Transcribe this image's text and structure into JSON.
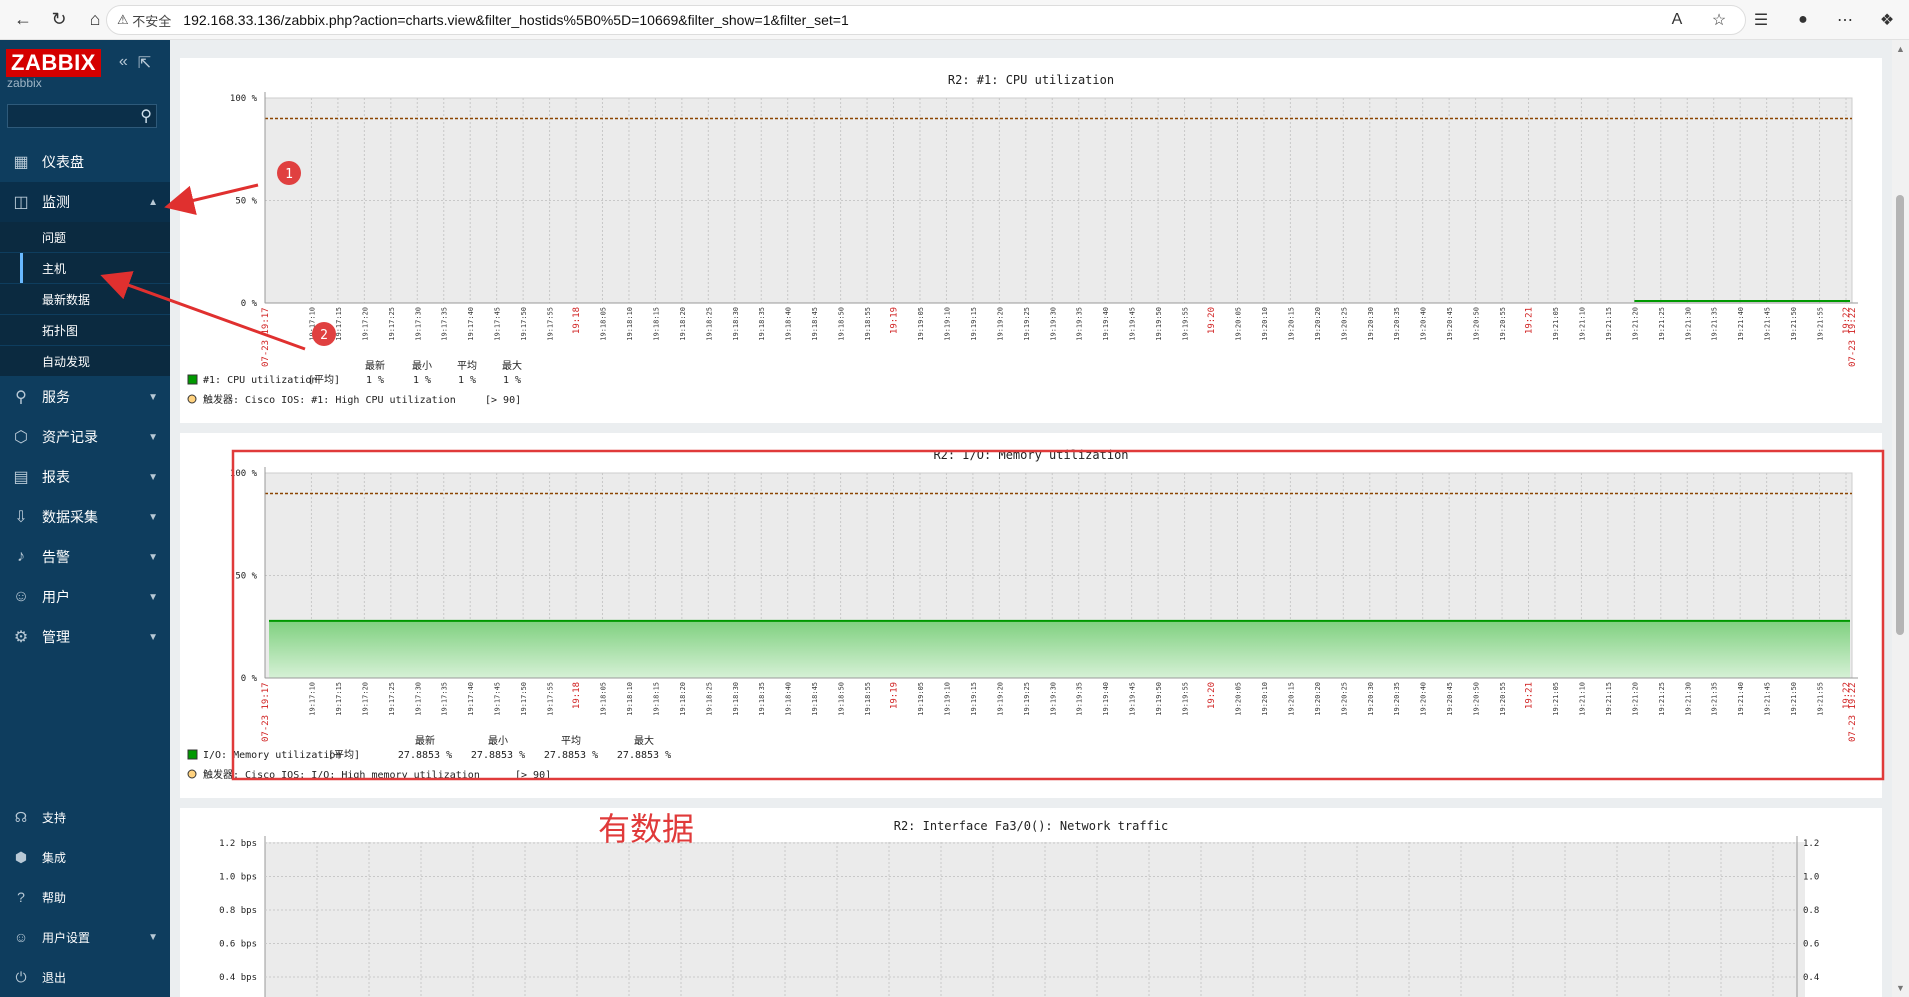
{
  "browser": {
    "security_label": "不安全",
    "url": "192.168.33.136/zabbix.php?action=charts.view&filter_hostids%5B0%5D=10669&filter_show=1&filter_set=1"
  },
  "sidebar": {
    "logo": "ZABBIX",
    "username": "zabbix",
    "search_placeholder": "",
    "items": [
      {
        "label": "仪表盘",
        "icon": "dashboard-icon"
      },
      {
        "label": "监测",
        "icon": "monitoring-icon"
      },
      {
        "label": "服务",
        "icon": "services-icon"
      },
      {
        "label": "资产记录",
        "icon": "inventory-icon"
      },
      {
        "label": "报表",
        "icon": "reports-icon"
      },
      {
        "label": "数据采集",
        "icon": "data-collection-icon"
      },
      {
        "label": "告警",
        "icon": "alerts-icon"
      },
      {
        "label": "用户",
        "icon": "users-icon"
      },
      {
        "label": "管理",
        "icon": "admin-icon"
      }
    ],
    "submenu": [
      "问题",
      "主机",
      "最新数据",
      "拓扑图",
      "自动发现"
    ],
    "bottom": [
      {
        "label": "支持",
        "icon": "support-icon"
      },
      {
        "label": "集成",
        "icon": "integrations-icon"
      },
      {
        "label": "帮助",
        "icon": "help-icon"
      },
      {
        "label": "用户设置",
        "icon": "user-settings-icon"
      },
      {
        "label": "退出",
        "icon": "logout-icon"
      }
    ]
  },
  "annotations": {
    "marker1": "1",
    "marker2": "2",
    "note": "有数据"
  },
  "legend_headers": {
    "last": "最新",
    "min": "最小",
    "avg": "平均",
    "max": "最大"
  },
  "chart_data": [
    {
      "type": "line",
      "title": "R2: #1: CPU utilization",
      "y_ticks": [
        "100 %",
        "50 %",
        "0 %"
      ],
      "ylim": [
        0,
        100
      ],
      "threshold": 90,
      "series": [
        {
          "name": "#1: CPU utilization",
          "func": "[平均]",
          "last": "1 %",
          "min": "1 %",
          "avg": "1 %",
          "max": "1 %",
          "color": "#009900",
          "x": [
            "19:21:20",
            "19:22:10"
          ],
          "values": [
            1,
            1
          ]
        }
      ],
      "trigger": {
        "label": "触发器: Cisco IOS: #1: High CPU utilization",
        "cond": "[> 90]"
      }
    },
    {
      "type": "area",
      "title": "R2: I/O: Memory utilization",
      "y_ticks": [
        "100 %",
        "50 %",
        "0 %"
      ],
      "ylim": [
        0,
        100
      ],
      "threshold": 90,
      "series": [
        {
          "name": "I/O: Memory utilization",
          "func": "[平均]",
          "last": "27.8853 %",
          "min": "27.8853 %",
          "avg": "27.8853 %",
          "max": "27.8853 %",
          "color": "#009900",
          "x": [
            "19:17:05",
            "19:22:10"
          ],
          "values": [
            27.8853,
            27.8853
          ]
        }
      ],
      "trigger": {
        "label": "触发器: Cisco IOS: I/O: High memory utilization",
        "cond": "[> 90]"
      }
    },
    {
      "type": "line",
      "title": "R2: Interface Fa3/0(): Network traffic",
      "y_ticks": [
        "1.2 bps",
        "1.0 bps",
        "0.8 bps",
        "0.6 bps",
        "0.4 bps"
      ],
      "y2_ticks": [
        "1.2",
        "1.0",
        "0.8",
        "0.6",
        "0.4"
      ],
      "series": []
    }
  ],
  "time_axis": {
    "start_label": "07-23 19:17",
    "end_label": "07-23 19:22",
    "ticks": [
      "19:17:10",
      "19:17:15",
      "19:17:20",
      "19:17:25",
      "19:17:30",
      "19:17:35",
      "19:17:40",
      "19:17:45",
      "19:17:50",
      "19:17:55",
      "19:18",
      "19:18:05",
      "19:18:10",
      "19:18:15",
      "19:18:20",
      "19:18:25",
      "19:18:30",
      "19:18:35",
      "19:18:40",
      "19:18:45",
      "19:18:50",
      "19:18:55",
      "19:19",
      "19:19:05",
      "19:19:10",
      "19:19:15",
      "19:19:20",
      "19:19:25",
      "19:19:30",
      "19:19:35",
      "19:19:40",
      "19:19:45",
      "19:19:50",
      "19:19:55",
      "19:20",
      "19:20:05",
      "19:20:10",
      "19:20:15",
      "19:20:20",
      "19:20:25",
      "19:20:30",
      "19:20:35",
      "19:20:40",
      "19:20:45",
      "19:20:50",
      "19:20:55",
      "19:21",
      "19:21:05",
      "19:21:10",
      "19:21:15",
      "19:21:20",
      "19:21:25",
      "19:21:30",
      "19:21:35",
      "19:21:40",
      "19:21:45",
      "19:21:50",
      "19:21:55",
      "19:22"
    ],
    "major": [
      "19:18",
      "19:19",
      "19:20",
      "19:21",
      "19:22"
    ]
  }
}
